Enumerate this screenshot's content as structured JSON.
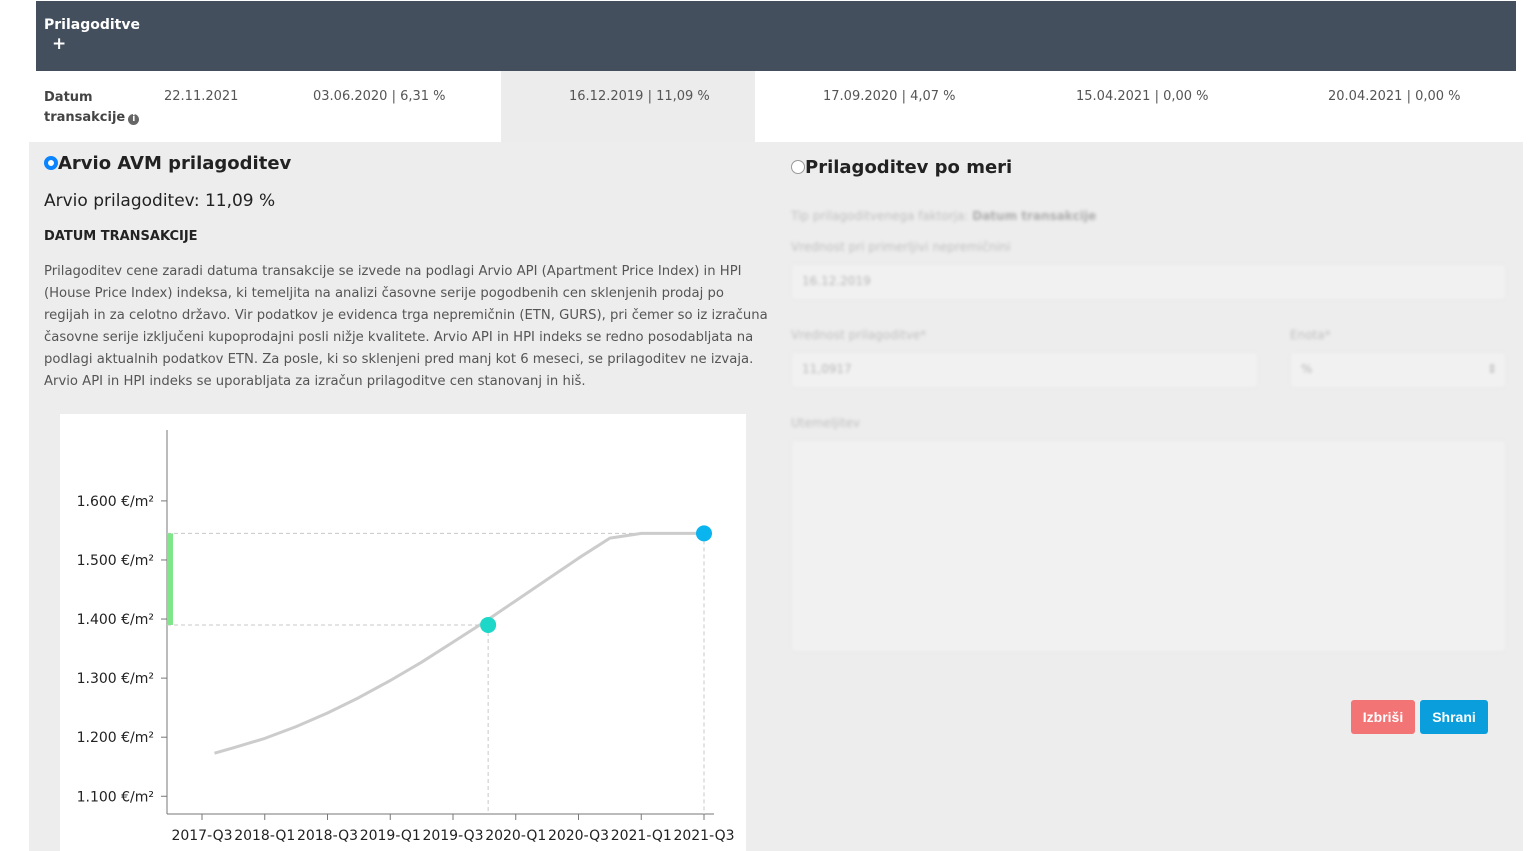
{
  "header": {
    "title": "Prilagoditve",
    "add_label": "+"
  },
  "date_row": {
    "label": "Datum transakcije",
    "info_icon": "info-icon",
    "cells": [
      "22.11.2021",
      "03.06.2020 | 6,31 %",
      "16.12.2019 | 11,09 %",
      "17.09.2020 | 4,07 %",
      "15.04.2021 | 0,00 %",
      "20.04.2021 | 0,00 %"
    ],
    "selected_index": 2
  },
  "left": {
    "option_title": "Arvio AVM prilagoditev",
    "option_selected": true,
    "value_text": "Arvio prilagoditev: 11,09 %",
    "section_heading": "DATUM TRANSAKCIJE",
    "description": "Prilagoditev cene zaradi datuma transakcije se izvede na podlagi Arvio API (Apartment Price Index) in HPI (House Price Index) indeksa, ki temeljita na analizi časovne serije pogodbenih cen sklenjenih prodaj po regijah in za celotno državo. Vir podatkov je evidenca trga nepremičnin (ETN, GURS), pri čemer so iz izračuna časovne serije izključeni kupoprodajni posli nižje kvalitete. Arvio API in HPI indeks se redno posodabljata na podlagi aktualnih podatkov ETN. Za posle, ki so sklenjeni pred manj kot 6 meseci, se prilagoditev ne izvaja. Arvio API in HPI indeks se uporabljata za izračun prilagoditve cen stanovanj in hiš."
  },
  "right": {
    "option_title": "Prilagoditev po meri",
    "option_selected": false,
    "subtitle_prefix": "Tip prilagoditvenega faktorja:",
    "subtitle_value": "Datum transakcije",
    "field1_label": "Vrednost pri primerljivi nepremičnini",
    "field1_value": "16.12.2019",
    "field2_label": "Vrednost prilagoditve*",
    "field2_value": "11,0917",
    "unit_label": "Enota*",
    "unit_value": "%",
    "notes_label": "Utemeljitev",
    "delete_label": "Izbriši",
    "save_label": "Shrani"
  },
  "colors": {
    "header_bg": "#434f5c",
    "line": "#cccccc",
    "comparable_point": "#1dd8c8",
    "target_point": "#0ab4ee",
    "adjustment_bar": "#7fe68a",
    "delete_btn": "#f27474",
    "save_btn": "#0a9fdc"
  },
  "chart_data": {
    "type": "line",
    "unit": "€/m²",
    "x_categories": [
      "2017-Q3",
      "2018-Q1",
      "2018-Q3",
      "2019-Q1",
      "2019-Q3",
      "2020-Q1",
      "2020-Q3",
      "2021-Q1",
      "2021-Q3"
    ],
    "ylim": [
      1070,
      1720
    ],
    "y_ticks": [
      1100,
      1200,
      1300,
      1400,
      1500,
      1600
    ],
    "y_tick_labels": [
      "1.100 €/m²",
      "1.200 €/m²",
      "1.300 €/m²",
      "1.400 €/m²",
      "1.500 €/m²",
      "1.600 €/m²"
    ],
    "series": [
      {
        "points": [
          {
            "q": 2017.6,
            "v": 1173
          },
          {
            "q": 2017.75,
            "v": 1182
          },
          {
            "q": 2018.0,
            "v": 1198
          },
          {
            "q": 2018.25,
            "v": 1218
          },
          {
            "q": 2018.5,
            "v": 1241
          },
          {
            "q": 2018.75,
            "v": 1267
          },
          {
            "q": 2019.0,
            "v": 1296
          },
          {
            "q": 2019.25,
            "v": 1327
          },
          {
            "q": 2019.5,
            "v": 1361
          },
          {
            "q": 2019.75,
            "v": 1395
          },
          {
            "q": 2020.0,
            "v": 1431
          },
          {
            "q": 2020.25,
            "v": 1467
          },
          {
            "q": 2020.5,
            "v": 1503
          },
          {
            "q": 2020.75,
            "v": 1537
          },
          {
            "q": 2021.0,
            "v": 1545
          },
          {
            "q": 2021.25,
            "v": 1545
          },
          {
            "q": 2021.5,
            "v": 1545
          }
        ]
      }
    ],
    "comparable_point": {
      "q": 2019.78,
      "v": 1390
    },
    "target_point": {
      "q": 2021.5,
      "v": 1545
    },
    "grid": false
  }
}
